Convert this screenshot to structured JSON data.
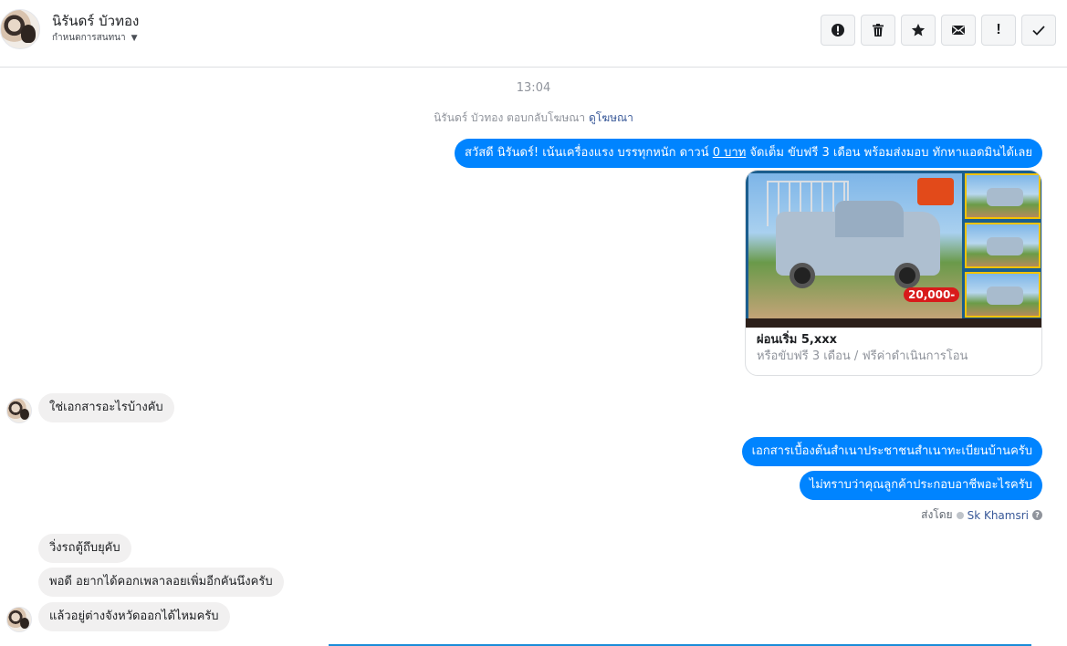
{
  "header": {
    "name": "นิรันดร์ บัวทอง",
    "assign_label": "กำหนดการสนทนา",
    "actions": [
      {
        "icon": "alert-circle-icon",
        "name": "spam-button"
      },
      {
        "icon": "trash-icon",
        "name": "delete-button"
      },
      {
        "icon": "star-icon",
        "name": "star-button"
      },
      {
        "icon": "mail-icon",
        "name": "mark-unread-button"
      },
      {
        "icon": "exclamation-icon",
        "name": "follow-up-button"
      },
      {
        "icon": "check-icon",
        "name": "done-button"
      }
    ]
  },
  "conversation": {
    "timestamp": "13:04",
    "reply_note_prefix": "นิรันดร์ บัวทอง ตอบกลับโฆษณา",
    "reply_note_link": "ดูโฆษณา",
    "greeting": {
      "part1": "สวัสดี นิรันดร์! เน้นเครื่องแรง บรรทุกหนัก ดาวน์ ",
      "underlined": "0 บาท",
      "part2": " จัดเต็ม ขับฟรี 3 เดือน พร้อมส่งมอบ ทักหาแอดมินได้เลย"
    },
    "ad_card": {
      "title": "ผ่อนเริ่ม 5,xxx",
      "subtitle": "หรือขับฟรี 3 เดือน / ฟรีค่าดำเนินการโอน",
      "price_tag": "20,000-"
    },
    "in_msg_1": "ใช่เอกสารอะไรบ้างคับ",
    "out_msg_1": "เอกสารเบื้องต้นสำเนาประชาชนสำเนาทะเบียนบ้านครับ",
    "out_msg_2": "ไม่ทราบว่าคุณลูกค้าประกอบอาชีพอะไรครับ",
    "sent_by_label": "ส่งโดย",
    "sent_by_agent": "Sk Khamsri",
    "in_msg_2": "วิ่งรถตู้ถึบยุคับ",
    "in_msg_3": "พอดี อยากได้คอกเพลาลอยเพิ่มอีกคันนึงครับ",
    "in_msg_4": "แล้วอยู่ต่างจังหวัดออกได้ไหมครับ"
  },
  "colors": {
    "outgoing_bubble": "#0084ff",
    "incoming_bubble": "#f1f0f0",
    "link": "#385898"
  }
}
